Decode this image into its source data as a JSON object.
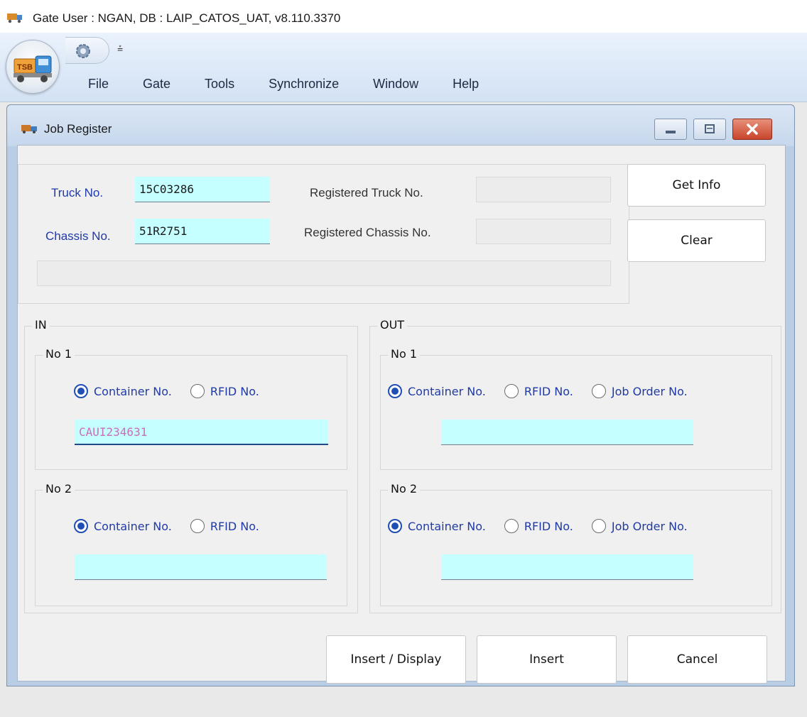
{
  "app": {
    "title": "Gate User : NGAN, DB : LAIP_CATOS_UAT, v8.110.3370",
    "orb_text": "TSB",
    "qat_dropdown": "⩮"
  },
  "menu": [
    "File",
    "Gate",
    "Tools",
    "Synchronize",
    "Window",
    "Help"
  ],
  "window": {
    "title": "Job Register"
  },
  "info": {
    "truck_label": "Truck No.",
    "truck_value": "15C03286",
    "chassis_label": "Chassis No.",
    "chassis_value": "51R2751",
    "reg_truck_label": "Registered Truck No.",
    "reg_truck_value": "",
    "reg_chassis_label": "Registered Chassis No.",
    "reg_chassis_value": "",
    "message": ""
  },
  "buttons": {
    "get_info": "Get Info",
    "clear": "Clear",
    "insert_display": "Insert / Display",
    "insert": "Insert",
    "cancel": "Cancel"
  },
  "in": {
    "title": "IN",
    "no1": {
      "title": "No 1",
      "opt_container": "Container No.",
      "opt_rfid": "RFID No.",
      "selected": "container",
      "value": "CAUI234631"
    },
    "no2": {
      "title": "No 2",
      "opt_container": "Container No.",
      "opt_rfid": "RFID No.",
      "selected": "container",
      "value": ""
    }
  },
  "out": {
    "title": "OUT",
    "no1": {
      "title": "No 1",
      "opt_container": "Container No.",
      "opt_rfid": "RFID No.",
      "opt_job": "Job Order No.",
      "selected": "container",
      "value": ""
    },
    "no2": {
      "title": "No 2",
      "opt_container": "Container No.",
      "opt_rfid": "RFID No.",
      "opt_job": "Job Order No.",
      "selected": "container",
      "value": ""
    }
  },
  "colors": {
    "input_bg": "#c6ffff",
    "label_blue": "#1f3aa8",
    "radio_blue": "#1f4fb5",
    "close_red": "#c9452c"
  }
}
